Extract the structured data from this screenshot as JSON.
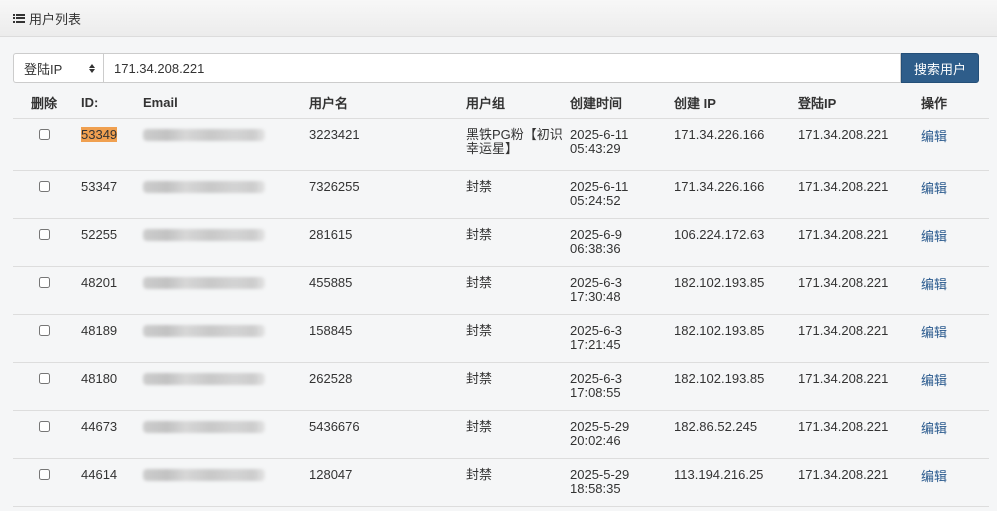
{
  "header": {
    "title": "用户列表",
    "icon": "list-icon"
  },
  "search": {
    "select_value": "登陆IP",
    "input_value": "171.34.208.221",
    "button_label": "搜索用户"
  },
  "table": {
    "columns": [
      "删除",
      "ID:",
      "Email",
      "用户名",
      "用户组",
      "创建时间",
      "创建 IP",
      "登陆IP",
      "操作"
    ],
    "rows": [
      {
        "id": "53349",
        "username": "3223421",
        "group": "黑铁PG粉【初识幸运星】",
        "date": "2025-6-11",
        "time": "05:43:29",
        "create_ip": "171.34.226.166",
        "login_ip": "171.34.208.221",
        "action": "编辑"
      },
      {
        "id": "53347",
        "username": "7326255",
        "group": "封禁",
        "date": "2025-6-11",
        "time": "05:24:52",
        "create_ip": "171.34.226.166",
        "login_ip": "171.34.208.221",
        "action": "编辑"
      },
      {
        "id": "52255",
        "username": "281615",
        "group": "封禁",
        "date": "2025-6-9",
        "time": "06:38:36",
        "create_ip": "106.224.172.63",
        "login_ip": "171.34.208.221",
        "action": "编辑"
      },
      {
        "id": "48201",
        "username": "455885",
        "group": "封禁",
        "date": "2025-6-3",
        "time": "17:30:48",
        "create_ip": "182.102.193.85",
        "login_ip": "171.34.208.221",
        "action": "编辑"
      },
      {
        "id": "48189",
        "username": "158845",
        "group": "封禁",
        "date": "2025-6-3",
        "time": "17:21:45",
        "create_ip": "182.102.193.85",
        "login_ip": "171.34.208.221",
        "action": "编辑"
      },
      {
        "id": "48180",
        "username": "262528",
        "group": "封禁",
        "date": "2025-6-3",
        "time": "17:08:55",
        "create_ip": "182.102.193.85",
        "login_ip": "171.34.208.221",
        "action": "编辑"
      },
      {
        "id": "44673",
        "username": "5436676",
        "group": "封禁",
        "date": "2025-5-29",
        "time": "20:02:46",
        "create_ip": "182.86.52.245",
        "login_ip": "171.34.208.221",
        "action": "编辑"
      },
      {
        "id": "44614",
        "username": "128047",
        "group": "封禁",
        "date": "2025-5-29",
        "time": "18:58:35",
        "create_ip": "113.194.216.25",
        "login_ip": "171.34.208.221",
        "action": "编辑"
      }
    ]
  },
  "colors": {
    "button_bg": "#2e5d8a",
    "link": "#2a5a8e",
    "highlight": "#f0a050"
  }
}
